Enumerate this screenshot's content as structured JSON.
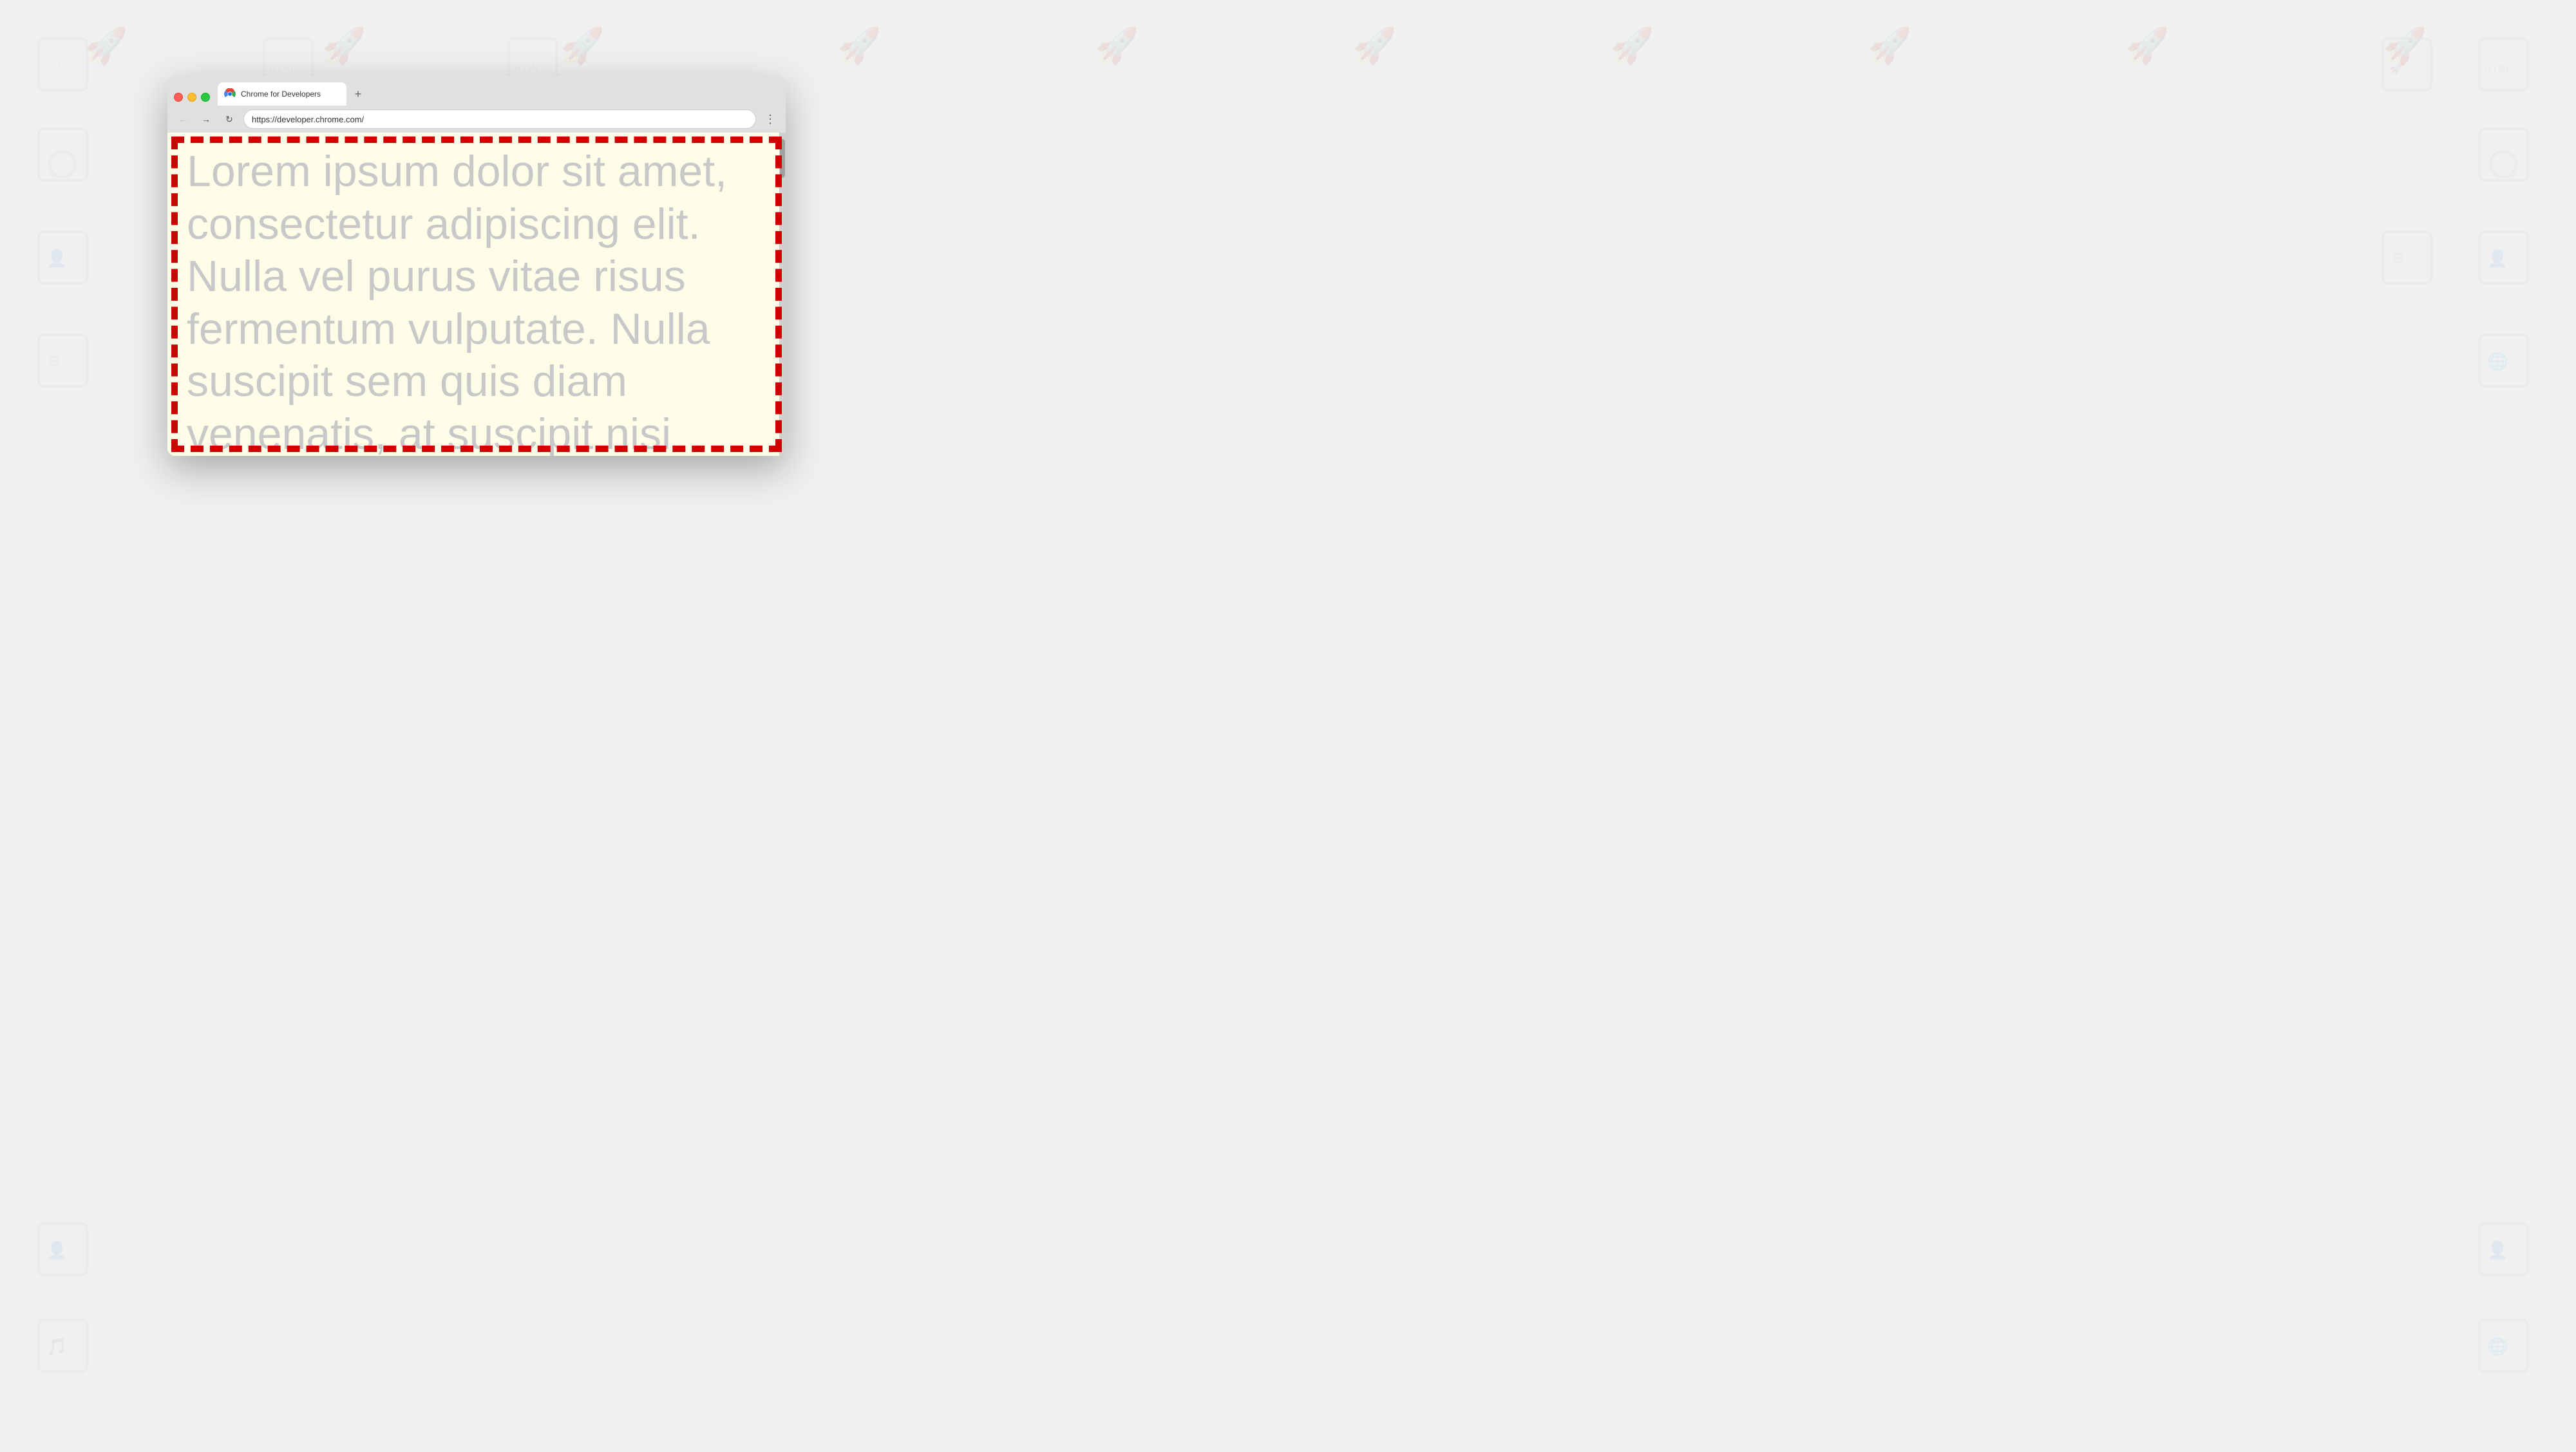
{
  "background": {
    "color": "#e8e8e8"
  },
  "browser": {
    "window_title": "Chrome for Developers",
    "tab": {
      "title": "Chrome for Developers",
      "favicon_alt": "chrome-logo"
    },
    "new_tab_label": "+",
    "toolbar": {
      "back_label": "←",
      "forward_label": "→",
      "reload_label": "↻",
      "url": "https://developer.chrome.com/",
      "menu_label": "⋮"
    },
    "page": {
      "lorem_text": "Lorem ipsum dolor sit amet, consectetur adipiscing elit. Nulla vel purus vitae risus fermentum vulputate. Nulla suscipit sem quis diam venenatis, at suscipit nisi eleifend. Nulla pretium eget",
      "background_color": "#fefee8",
      "border_color": "#cc0000"
    }
  }
}
